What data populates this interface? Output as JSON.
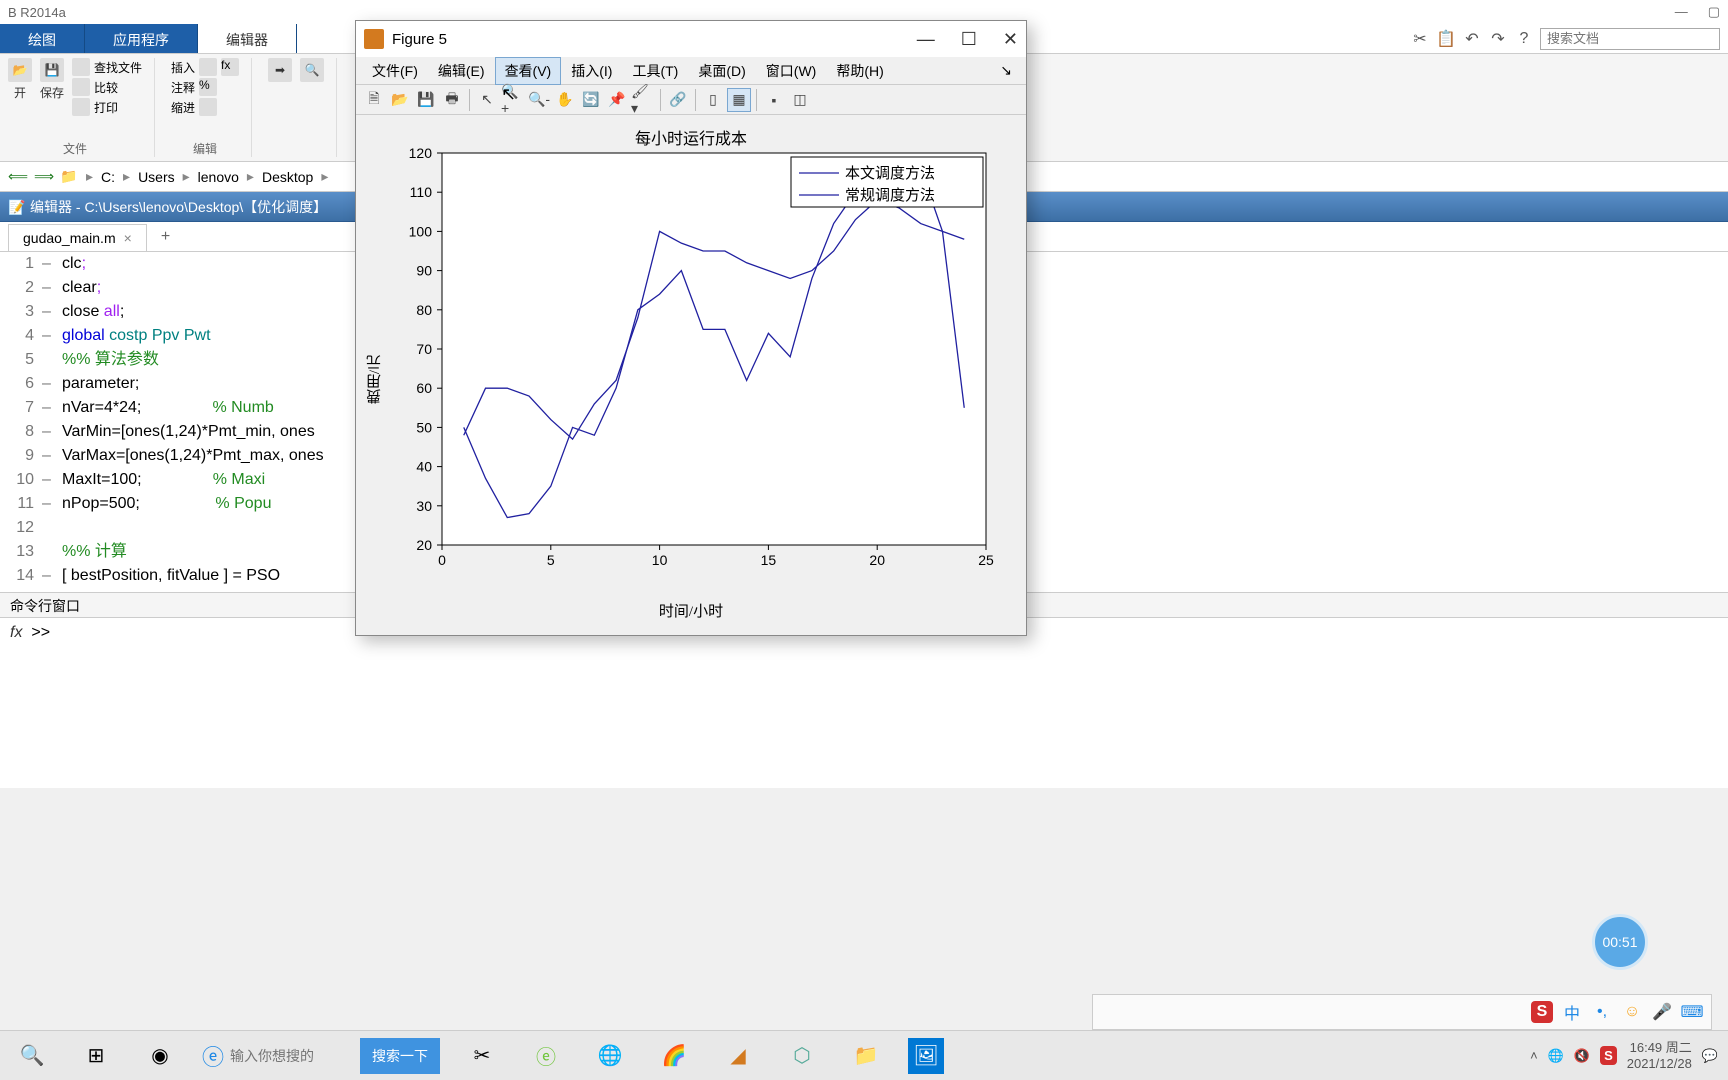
{
  "matlab": {
    "title": "B R2014a",
    "ribbon_tabs": [
      "绘图",
      "应用程序",
      "编辑器"
    ],
    "search_docs_placeholder": "搜索文档",
    "toolstrip": {
      "open_label": "开",
      "save_label": "保存",
      "find_files": "查找文件",
      "compare": "比较",
      "print": "打印",
      "insert": "插入",
      "comment": "注释",
      "indent": "缩进",
      "group_file": "文件",
      "group_edit": "编辑"
    },
    "addr": [
      "C:",
      "Users",
      "lenovo",
      "Desktop"
    ],
    "editor_title": "编辑器 - C:\\Users\\lenovo\\Desktop\\【优化调度】",
    "file_tab": "gudao_main.m",
    "code_lines": [
      {
        "n": 1,
        "mark": "–",
        "html": "clc<span class='kw-purple'>;</span>"
      },
      {
        "n": 2,
        "mark": "–",
        "html": "clear<span class='kw-purple'>;</span>"
      },
      {
        "n": 3,
        "mark": "–",
        "html": "close <span class='kw-purple'>all</span>;"
      },
      {
        "n": 4,
        "mark": "–",
        "html": "<span class='kw-blue'>global</span> <span class='kw-teal'>costp Ppv Pwt</span>"
      },
      {
        "n": 5,
        "mark": "",
        "html": "<span class='kw-green'>%% 算法参数</span>"
      },
      {
        "n": 6,
        "mark": "–",
        "html": "parameter;"
      },
      {
        "n": 7,
        "mark": "–",
        "html": "nVar=4*24;                <span class='kw-green'>% Numb</span>"
      },
      {
        "n": 8,
        "mark": "–",
        "html": "VarMin=[ones(1,24)*Pmt_min, ones"
      },
      {
        "n": 9,
        "mark": "–",
        "html": "VarMax=[ones(1,24)*Pmt_max, ones"
      },
      {
        "n": 10,
        "mark": "–",
        "html": "MaxIt=100;                <span class='kw-green'>% Maxi</span>"
      },
      {
        "n": 11,
        "mark": "–",
        "html": "nPop=500;                 <span class='kw-green'>% Popu</span>"
      },
      {
        "n": 12,
        "mark": "",
        "html": ""
      },
      {
        "n": 13,
        "mark": "",
        "html": "<span class='kw-green'>%% 计算</span>"
      },
      {
        "n": 14,
        "mark": "–",
        "html": "[ bestPosition, fitValue ] = PSO"
      }
    ],
    "cmd_title": "命令行窗口",
    "cmd_prompt_fx": "fx",
    "cmd_prompt": ">>"
  },
  "figure": {
    "title": "Figure 5",
    "menus": [
      "文件(F)",
      "编辑(E)",
      "查看(V)",
      "插入(I)",
      "工具(T)",
      "桌面(D)",
      "窗口(W)",
      "帮助(H)"
    ]
  },
  "chart_data": {
    "type": "line",
    "title": "每小时运行成本",
    "xlabel": "时间/小时",
    "ylabel": "费用/元",
    "xlim": [
      0,
      25
    ],
    "ylim": [
      20,
      120
    ],
    "xticks": [
      0,
      5,
      10,
      15,
      20,
      25
    ],
    "yticks": [
      20,
      30,
      40,
      50,
      60,
      70,
      80,
      90,
      100,
      110,
      120
    ],
    "legend_position": "top-right",
    "series": [
      {
        "name": "本文调度方法",
        "color": "#2020a0",
        "x": [
          1,
          2,
          3,
          4,
          5,
          6,
          7,
          8,
          9,
          10,
          11,
          12,
          13,
          14,
          15,
          16,
          17,
          18,
          19,
          20,
          21,
          22,
          23,
          24
        ],
        "y": [
          50,
          37,
          27,
          28,
          35,
          50,
          48,
          60,
          80,
          84,
          90,
          75,
          75,
          62,
          74,
          68,
          88,
          102,
          110,
          107,
          118,
          116,
          100,
          55
        ]
      },
      {
        "name": "常规调度方法",
        "color": "#2020a0",
        "x": [
          1,
          2,
          3,
          4,
          5,
          6,
          7,
          8,
          9,
          10,
          11,
          12,
          13,
          14,
          15,
          16,
          17,
          18,
          19,
          20,
          21,
          22,
          23,
          24
        ],
        "y": [
          48,
          60,
          60,
          58,
          52,
          47,
          56,
          62,
          78,
          100,
          97,
          95,
          95,
          92,
          90,
          88,
          90,
          95,
          103,
          108,
          106,
          102,
          100,
          98
        ]
      }
    ]
  },
  "taskbar": {
    "search_placeholder": "输入你想搜的",
    "search_btn": "搜索一下",
    "ime_zhong": "中",
    "time": "16:49",
    "day": "周二",
    "date": "2021/12/28"
  },
  "timer": "00:51",
  "sogou": "S"
}
